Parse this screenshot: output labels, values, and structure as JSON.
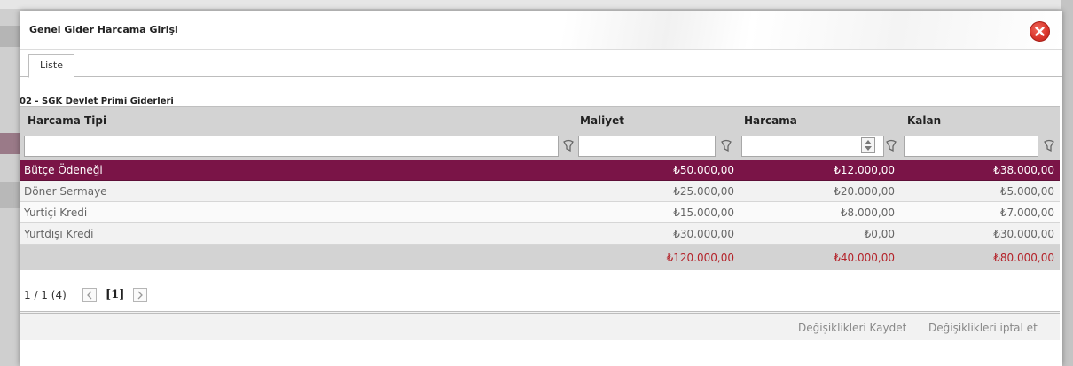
{
  "dialog": {
    "title": "Genel Gider Harcama Girişi"
  },
  "tabs": [
    {
      "label": "Liste",
      "active": true
    }
  ],
  "section": {
    "label": "02 - SGK Devlet Primi Giderleri"
  },
  "grid": {
    "columns": [
      "Harcama Tipi",
      "Maliyet",
      "Harcama",
      "Kalan"
    ],
    "filters": {
      "harcama_tipi": "",
      "maliyet": "",
      "harcama": "",
      "kalan": ""
    },
    "rows": [
      {
        "type": "Bütçe Ödeneği",
        "maliyet": "₺50.000,00",
        "harcama": "₺12.000,00",
        "kalan": "₺38.000,00",
        "selected": true
      },
      {
        "type": "Döner Sermaye",
        "maliyet": "₺25.000,00",
        "harcama": "₺20.000,00",
        "kalan": "₺5.000,00"
      },
      {
        "type": "Yurtiçi Kredi",
        "maliyet": "₺15.000,00",
        "harcama": "₺8.000,00",
        "kalan": "₺7.000,00"
      },
      {
        "type": "Yurtdışı Kredi",
        "maliyet": "₺30.000,00",
        "harcama": "₺0,00",
        "kalan": "₺30.000,00"
      }
    ],
    "totals": {
      "maliyet": "₺120.000,00",
      "harcama": "₺40.000,00",
      "kalan": "₺80.000,00"
    }
  },
  "pager": {
    "info": "1 / 1 (4)",
    "current": "[1]"
  },
  "actions": {
    "save_label": "Değişiklikleri Kaydet",
    "cancel_label": "Değişiklikleri iptal et"
  },
  "colors": {
    "selected_row": "#7a1447",
    "totals_text": "#b4232a",
    "close_button": "#d9342a"
  },
  "icons": {
    "close": "close-icon",
    "filter": "filter-icon",
    "prev": "chevron-left-icon",
    "next": "chevron-right-icon",
    "spinner": "spinner-icon"
  }
}
